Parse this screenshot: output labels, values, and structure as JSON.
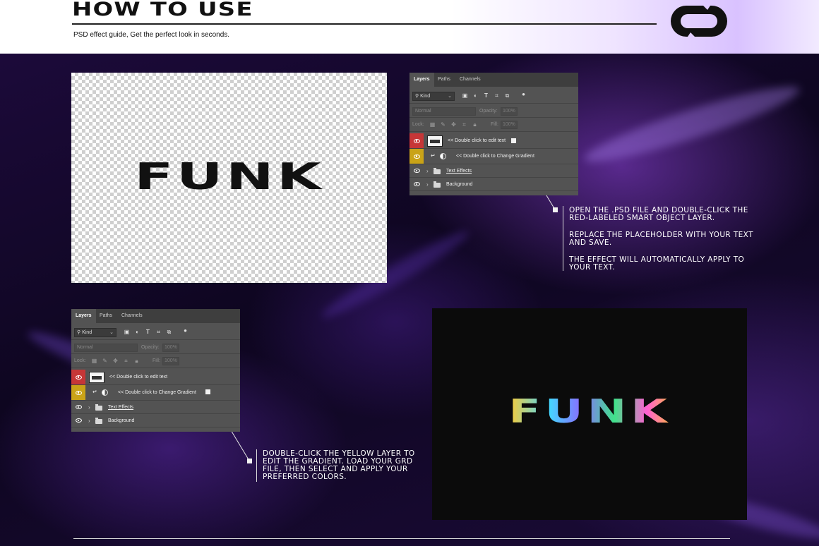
{
  "header": {
    "title": "HOW TO USE",
    "subtitle": "PSD effect guide, Get the perfect look in seconds."
  },
  "canvas_preview": {
    "text": "FUNK"
  },
  "result_preview": {
    "text": "FUNK"
  },
  "layers_panel": {
    "tabs": [
      "Layers",
      "Paths",
      "Channels"
    ],
    "filter_kind": "Kind",
    "blend_mode": "Normal",
    "opacity_label": "Opacity:",
    "opacity_value": "100%",
    "lock_label": "Lock:",
    "fill_label": "Fill:",
    "fill_value": "100%",
    "layers": [
      {
        "name": "<< Double click to edit text",
        "label_color": "#c63637"
      },
      {
        "name": "<< Double click to Change Gradient",
        "label_color": "#c9a317"
      },
      {
        "name": "Text Effects"
      },
      {
        "name": "Background"
      }
    ]
  },
  "callout_top": {
    "paragraphs": [
      "OPEN THE .PSD FILE AND DOUBLE-CLICK THE RED-LABELED SMART OBJECT LAYER.",
      "REPLACE THE PLACEHOLDER WITH YOUR TEXT AND SAVE.",
      "THE EFFECT WILL AUTOMATICALLY APPLY TO YOUR TEXT."
    ]
  },
  "callout_bottom": {
    "paragraphs": [
      "DOUBLE-CLICK THE YELLOW LAYER TO EDIT THE GRADIENT. LOAD YOUR GRD FILE, THEN SELECT AND APPLY YOUR PREFERRED COLORS."
    ]
  },
  "icons": [
    "brand-logo-icon",
    "search-icon",
    "eye-icon",
    "folder-icon",
    "chevron-right-icon",
    "lock-icon"
  ]
}
